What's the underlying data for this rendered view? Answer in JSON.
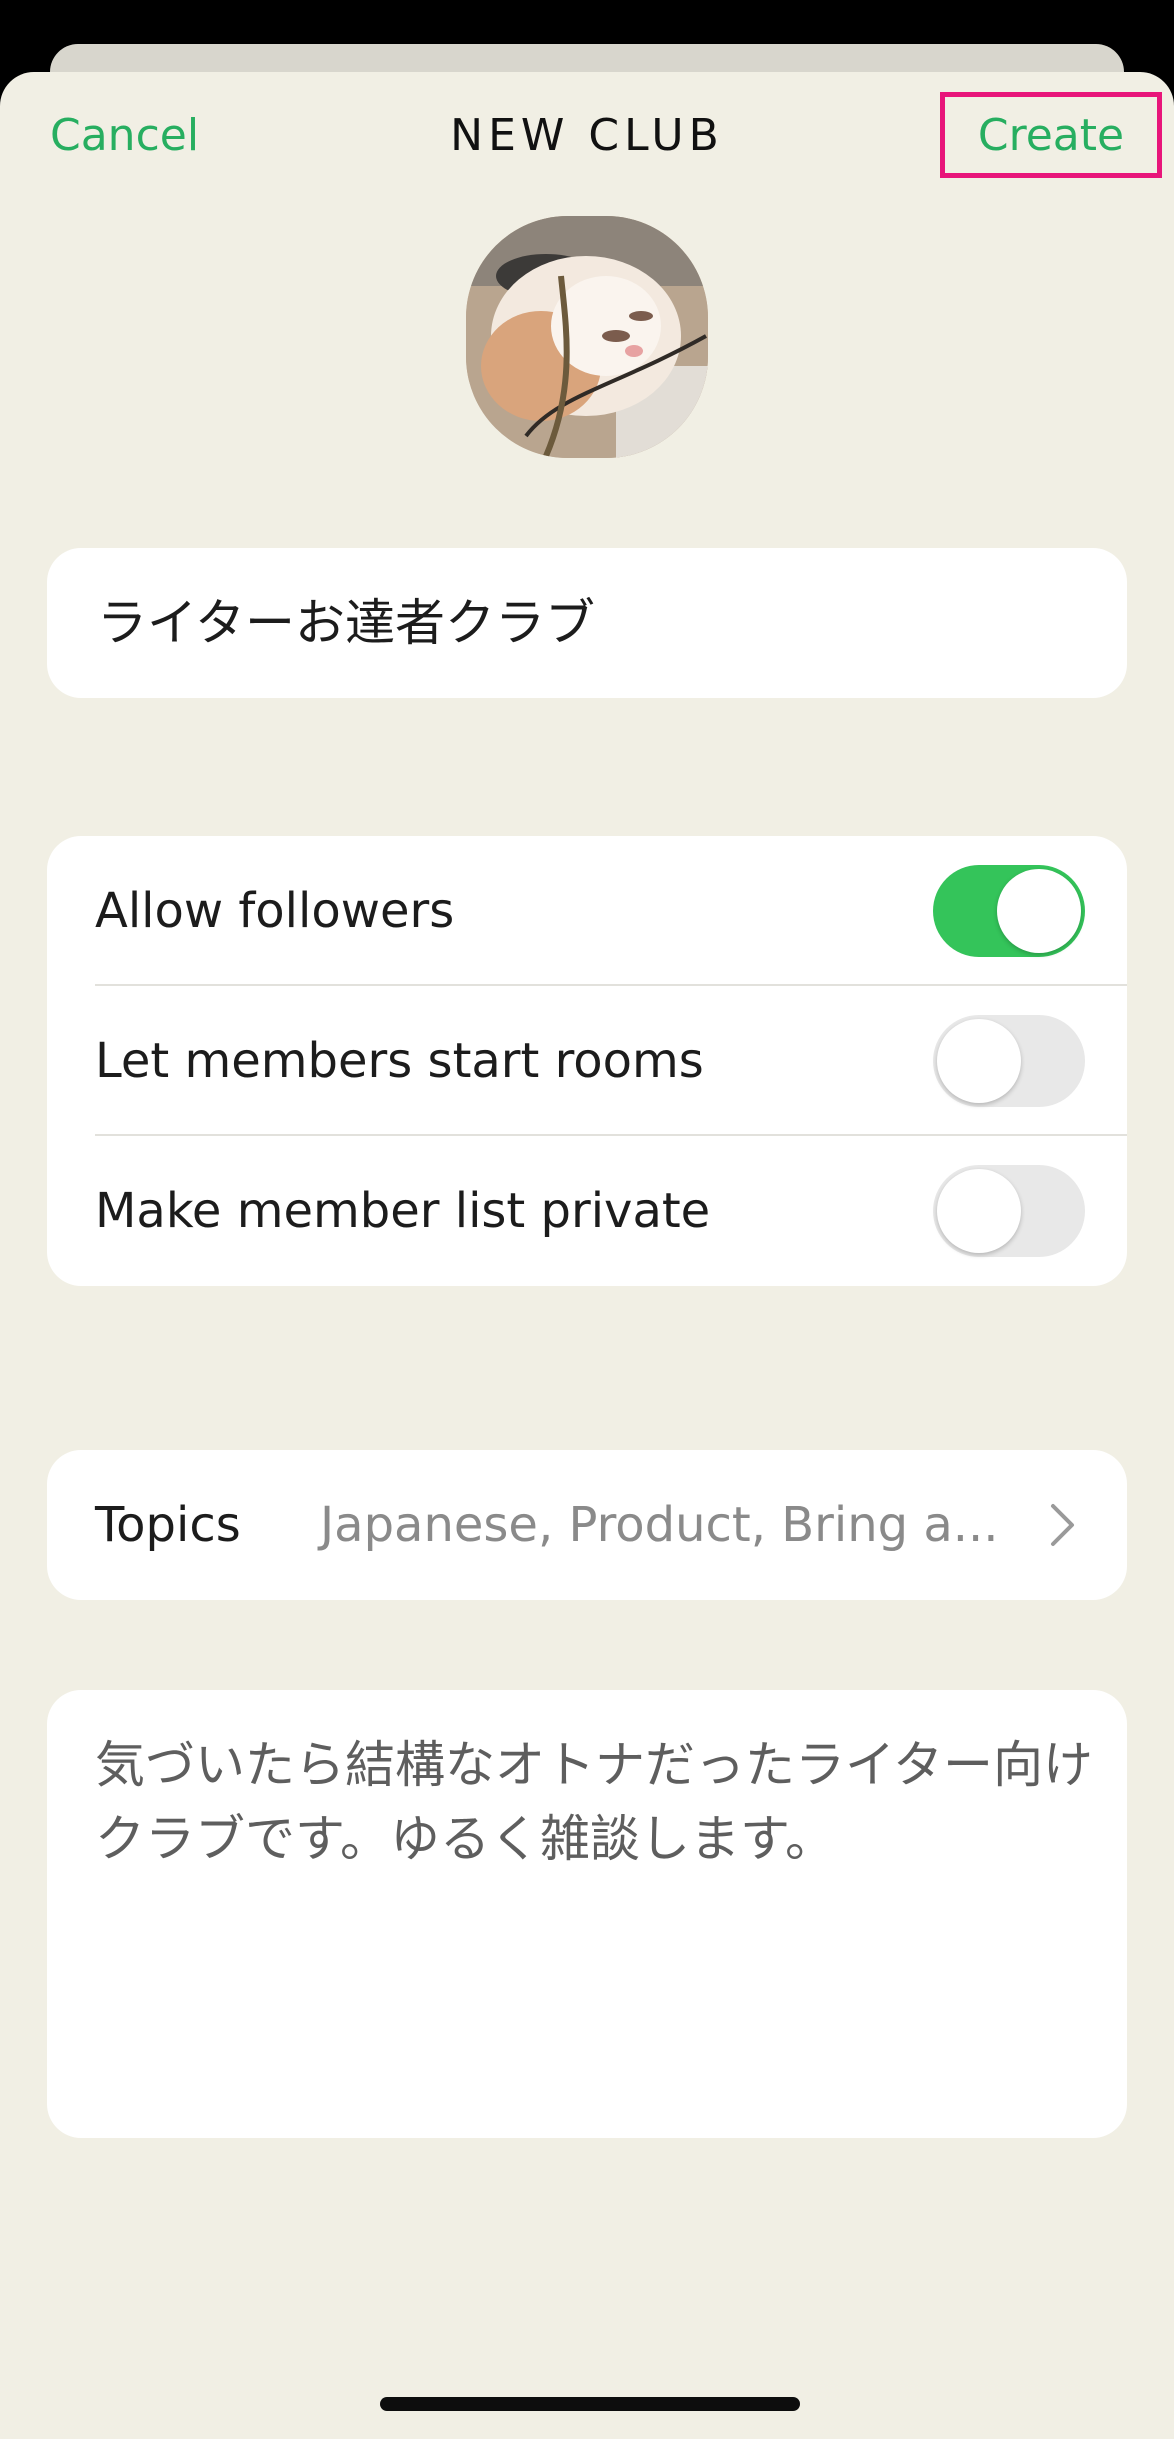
{
  "header": {
    "cancel_label": "Cancel",
    "title": "NEW CLUB",
    "create_label": "Create"
  },
  "avatar": {
    "icon": "club-photo-sleeping-cat"
  },
  "club_name": {
    "value": "ライターお達者クラブ"
  },
  "settings": {
    "items": [
      {
        "label": "Allow followers",
        "enabled": true
      },
      {
        "label": "Let members start rooms",
        "enabled": false
      },
      {
        "label": "Make member list private",
        "enabled": false
      }
    ]
  },
  "topics": {
    "label": "Topics",
    "value": "Japanese,  Product,  Bring a...",
    "icon": "chevron-right-icon"
  },
  "description": {
    "value": "気づいたら結構なオトナだったライター向けクラブです。ゆるく雑談します。"
  },
  "colors": {
    "accent_green": "#27ae60",
    "toggle_on": "#34c45a",
    "highlight_box": "#e8157a",
    "background": "#f1efe4"
  }
}
